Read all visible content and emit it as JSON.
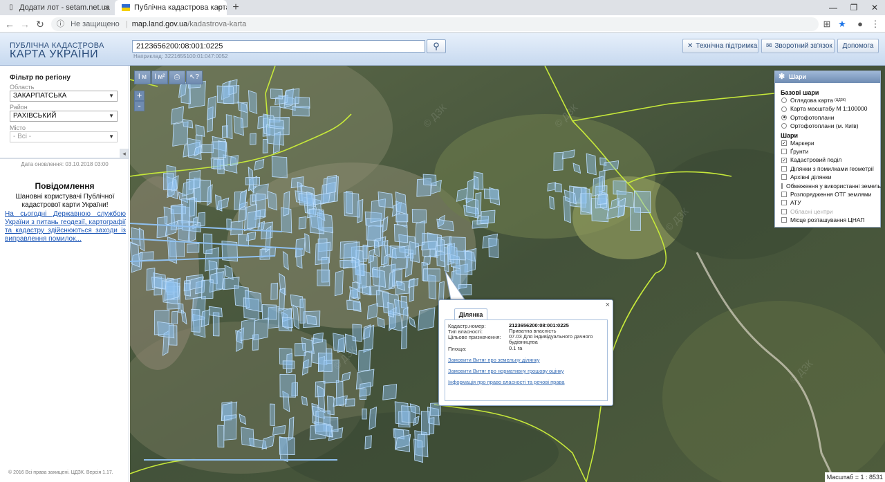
{
  "browser": {
    "tabs": [
      {
        "title": "Додати лот - setam.net.ua",
        "icon": "document-icon"
      },
      {
        "title": "Публічна кадастрова карта Укр",
        "icon": "ukraine-flag-icon"
      }
    ],
    "security_label": "Не защищено",
    "url_host": "map.land.gov.ua",
    "url_path": "/kadastrova-karta"
  },
  "header": {
    "logo_line1": "ПУБЛІЧНА КАДАСТРОВА",
    "logo_line2": "КАРТА УКРАЇНИ",
    "search_value": "2123656200:08:001:0225",
    "search_hint": "Наприклад: 3221655100:01:047:0052",
    "buttons": {
      "support": "Технічна підтримка",
      "feedback": "Зворотний зв'язок",
      "help": "Допомога"
    }
  },
  "filter": {
    "title": "Фільтр по регіону",
    "oblast_label": "Область",
    "oblast_value": "ЗАКАРПАТСЬКА",
    "raion_label": "Район",
    "raion_value": "РАХІВСЬКИЙ",
    "misto_label": "Місто",
    "misto_value": "- Всі -",
    "collapse": "◂"
  },
  "date_updated": "Дата оновлення: 03.10.2018 03:00",
  "notice": {
    "title": "Повідомлення",
    "text": "Шановні користувачі Публічної кадастрової карти України!",
    "link": "На сьогодні Державною службою України з питань геодезії, картографії та кадастру здійснюються заходи із виправлення помилок..."
  },
  "copyright": "© 2016 Всі права захищені. ЦДЗК. Версія 1.17.",
  "map": {
    "tools": [
      "l м",
      "l м²",
      "⎙",
      "↖?"
    ],
    "zoom_in": "+",
    "zoom_out": "-",
    "scale": "Масштаб = 1 : 8531"
  },
  "layers": {
    "title": "Шари",
    "base_title": "Базові шари",
    "base": [
      {
        "label": "Оглядова карта",
        "sup": "(ЦДЗК)",
        "checked": false
      },
      {
        "label": "Карта масштабу М 1:100000",
        "checked": false
      },
      {
        "label": "Ортофотоплани",
        "checked": true
      },
      {
        "label": "Ортофотоплани (м. Київ)",
        "checked": false
      }
    ],
    "overlay_title": "Шари",
    "overlays": [
      {
        "label": "Маркери",
        "checked": true,
        "disabled": false
      },
      {
        "label": "Ґрунти",
        "checked": false,
        "disabled": false
      },
      {
        "label": "Кадастровий поділ",
        "checked": true,
        "disabled": false
      },
      {
        "label": "Ділянки з помилками геометрії",
        "checked": false,
        "disabled": false
      },
      {
        "label": "Архівні ділянки",
        "checked": false,
        "disabled": false
      },
      {
        "label": "Обмеження у використанні земель",
        "checked": false,
        "disabled": false
      },
      {
        "label": "Розпорядження ОТГ землями",
        "checked": false,
        "disabled": false
      },
      {
        "label": "АТУ",
        "checked": false,
        "disabled": false
      },
      {
        "label": "Обласні центри",
        "checked": false,
        "disabled": true
      },
      {
        "label": "Місце розташування ЦНАП",
        "checked": false,
        "disabled": false
      }
    ]
  },
  "popup": {
    "tab": "Ділянка",
    "close": "×",
    "fields": [
      {
        "key": "Кадастр.номер:",
        "value": "2123656200:08:001:0225"
      },
      {
        "key": "Тип власності:",
        "value": "Приватна власність"
      },
      {
        "key": "Цільове призначення:",
        "value": "07.03 Для індивідуального дачного будівництва"
      },
      {
        "key": "Площа:",
        "value": "0.1 га"
      }
    ],
    "links": [
      "Замовити Витяг про земельну ділянку",
      "Замовити Витяг про нормативну грошову оцінку",
      "Інформація про право власності та речові права"
    ]
  },
  "colors": {
    "parcel_fill": "#8fc0f0",
    "parcel_stroke": "#bfe0ff",
    "boundary_line": "#c6e83a",
    "link": "#3a6fb6"
  }
}
